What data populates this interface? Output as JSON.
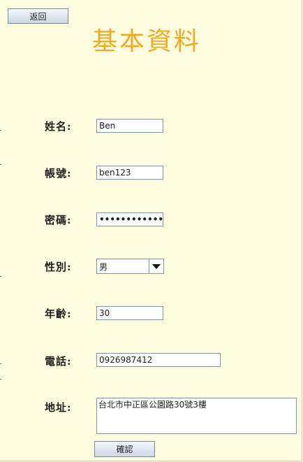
{
  "header": {
    "back_label": "返回",
    "title": "基本資料"
  },
  "form": {
    "name": {
      "label": "姓名:",
      "value": "Ben"
    },
    "account": {
      "label": "帳號:",
      "value": "ben123"
    },
    "password": {
      "label": "密碼:",
      "value": "••••••••••••••••••"
    },
    "gender": {
      "label": "性別:",
      "value": "男"
    },
    "age": {
      "label": "年齡:",
      "value": "30"
    },
    "phone": {
      "label": "電話:",
      "value": "0926987412"
    },
    "address": {
      "label": "地址:",
      "value": "台北市中正區公園路30號3樓"
    }
  },
  "footer": {
    "confirm_label": "確認"
  }
}
